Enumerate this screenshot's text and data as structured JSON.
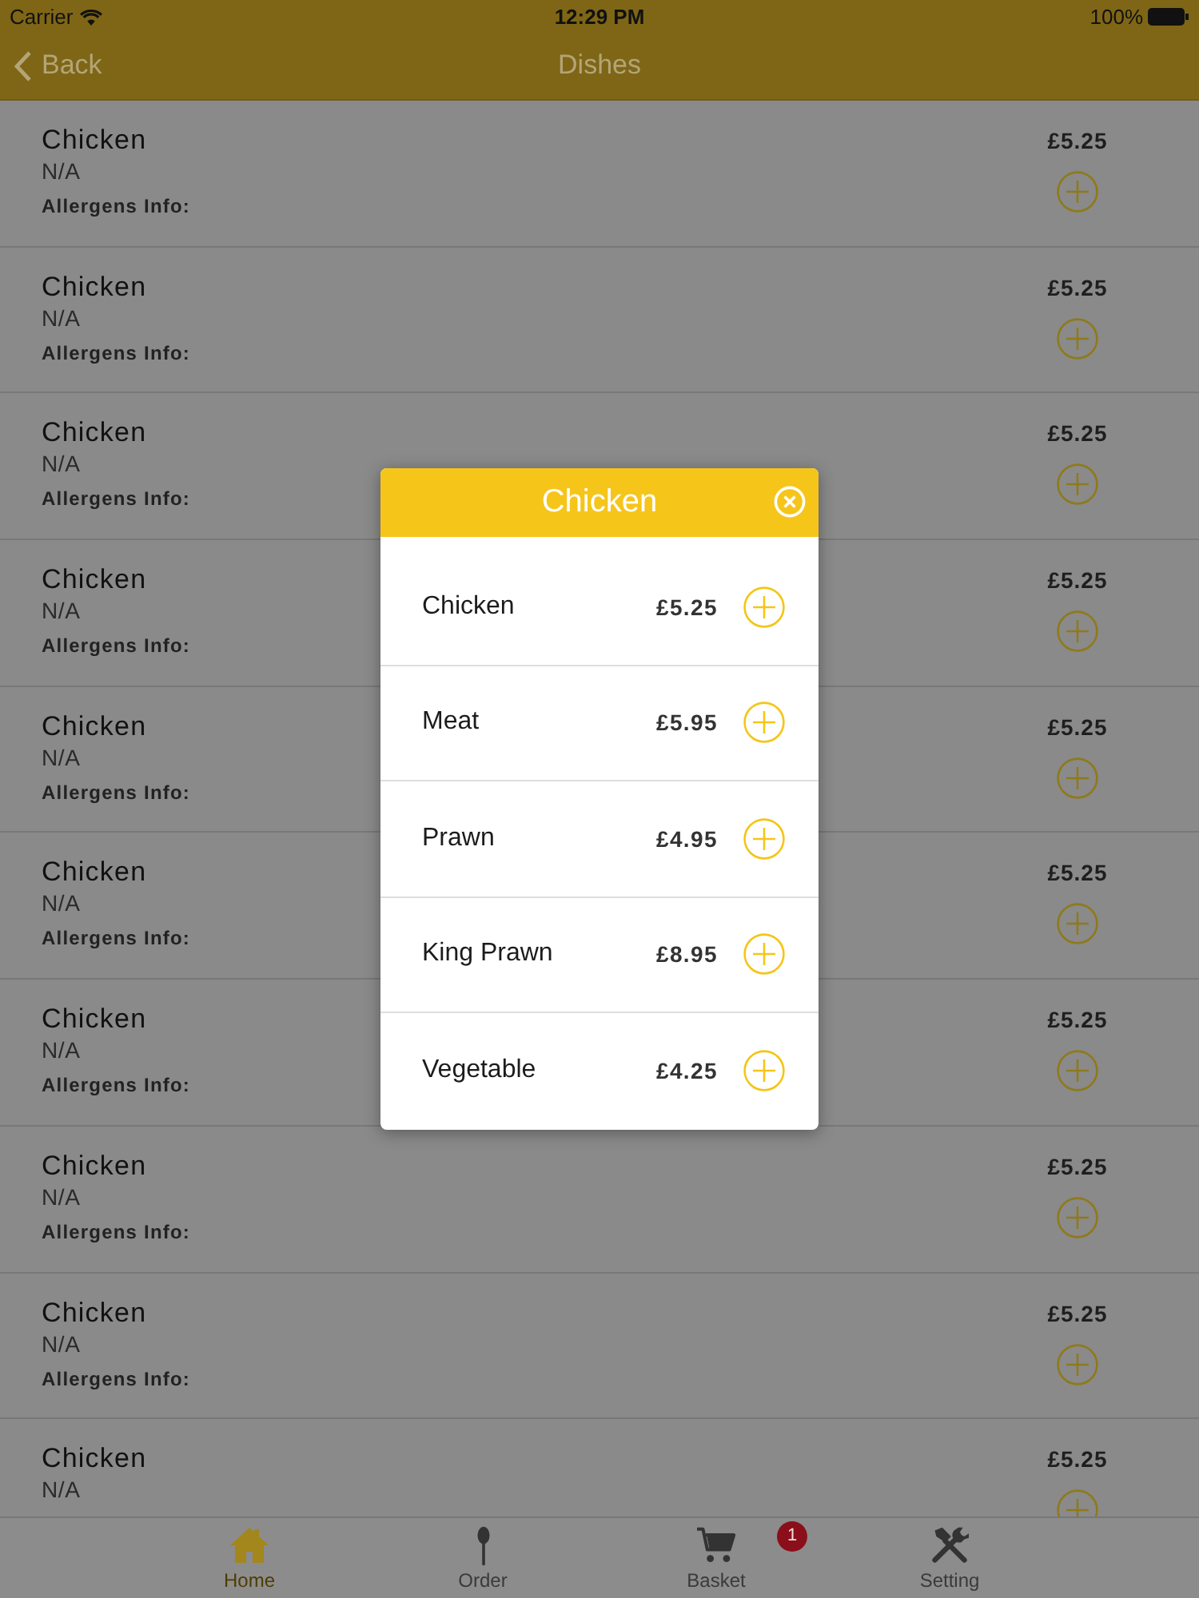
{
  "status_bar": {
    "carrier": "Carrier",
    "time": "12:29 PM",
    "battery": "100%"
  },
  "nav_bar": {
    "back": "Back",
    "title": "Dishes"
  },
  "dishes": [
    {
      "name": "Chicken",
      "description": "N/A",
      "allergens_label": "Allergens Info:",
      "price": "£5.25"
    },
    {
      "name": "Chicken",
      "description": "N/A",
      "allergens_label": "Allergens Info:",
      "price": "£5.25"
    },
    {
      "name": "Chicken",
      "description": "N/A",
      "allergens_label": "Allergens Info:",
      "price": "£5.25"
    },
    {
      "name": "Chicken",
      "description": "N/A",
      "allergens_label": "Allergens Info:",
      "price": "£5.25"
    },
    {
      "name": "Chicken",
      "description": "N/A",
      "allergens_label": "Allergens Info:",
      "price": "£5.25"
    },
    {
      "name": "Chicken",
      "description": "N/A",
      "allergens_label": "Allergens Info:",
      "price": "£5.25"
    },
    {
      "name": "Chicken",
      "description": "N/A",
      "allergens_label": "Allergens Info:",
      "price": "£5.25"
    },
    {
      "name": "Chicken",
      "description": "N/A",
      "allergens_label": "Allergens Info:",
      "price": "£5.25"
    },
    {
      "name": "Chicken",
      "description": "N/A",
      "allergens_label": "Allergens Info:",
      "price": "£5.25"
    },
    {
      "name": "Chicken",
      "description": "N/A",
      "price": "£5.25"
    }
  ],
  "dialog": {
    "title": "Chicken",
    "options": [
      {
        "name": "Chicken",
        "price": "£5.25"
      },
      {
        "name": "Meat",
        "price": "£5.95"
      },
      {
        "name": "Prawn",
        "price": "£4.95"
      },
      {
        "name": "King Prawn",
        "price": "£8.95"
      },
      {
        "name": "Vegetable",
        "price": "£4.25"
      }
    ]
  },
  "tab_bar": {
    "tabs": [
      {
        "kind": "home",
        "label": "Home",
        "selected": true
      },
      {
        "kind": "order",
        "label": "Order",
        "selected": false
      },
      {
        "kind": "basket",
        "label": "Basket",
        "selected": false,
        "badge": "1"
      },
      {
        "kind": "setting",
        "label": "Setting",
        "selected": false
      }
    ]
  }
}
